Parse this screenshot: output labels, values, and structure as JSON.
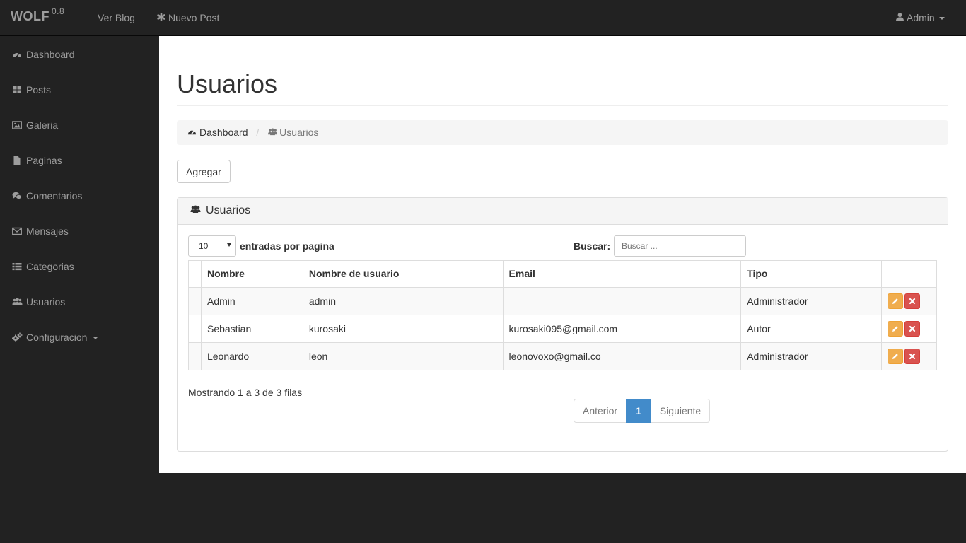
{
  "navbar": {
    "brand": "WOLF",
    "version": "0.8",
    "links": [
      {
        "label": "Ver Blog",
        "icon": "none"
      },
      {
        "label": "Nuevo Post",
        "icon": "asterisk-icon"
      }
    ],
    "user": {
      "label": "Admin",
      "icon": "user-icon"
    }
  },
  "sidebar": {
    "items": [
      {
        "label": "Dashboard",
        "icon": "dashboard-icon"
      },
      {
        "label": "Posts",
        "icon": "th-large-icon"
      },
      {
        "label": "Galeria",
        "icon": "picture-icon"
      },
      {
        "label": "Paginas",
        "icon": "file-icon"
      },
      {
        "label": "Comentarios",
        "icon": "comments-icon"
      },
      {
        "label": "Mensajes",
        "icon": "envelope-icon"
      },
      {
        "label": "Categorias",
        "icon": "list-icon"
      },
      {
        "label": "Usuarios",
        "icon": "users-icon"
      },
      {
        "label": "Configuracion",
        "icon": "cogs-icon"
      }
    ]
  },
  "page": {
    "title": "Usuarios",
    "breadcrumb": {
      "home": "Dashboard",
      "current": "Usuarios"
    },
    "add_button": "Agregar"
  },
  "panel": {
    "title": "Usuarios",
    "length": {
      "value": "10",
      "label": "entradas por pagina"
    },
    "search": {
      "label": "Buscar:",
      "placeholder": "Buscar ..."
    },
    "columns": [
      "",
      "Nombre",
      "Nombre de usuario",
      "Email",
      "Tipo",
      ""
    ],
    "rows": [
      {
        "nombre": "Admin",
        "usuario": "admin",
        "email": "",
        "tipo": "Administrador"
      },
      {
        "nombre": "Sebastian",
        "usuario": "kurosaki",
        "email": "kurosaki095@gmail.com",
        "tipo": "Autor"
      },
      {
        "nombre": "Leonardo",
        "usuario": "leon",
        "email": "leonovoxo@gmail.co",
        "tipo": "Administrador"
      }
    ],
    "info": "Mostrando 1 a 3 de 3 filas",
    "pager": {
      "prev": "Anterior",
      "current": "1",
      "next": "Siguiente"
    }
  },
  "colors": {
    "navbar_bg": "#222222",
    "content_bg": "#ffffff",
    "primary": "#428bca",
    "warning": "#f0ad4e",
    "danger": "#d9534f"
  }
}
